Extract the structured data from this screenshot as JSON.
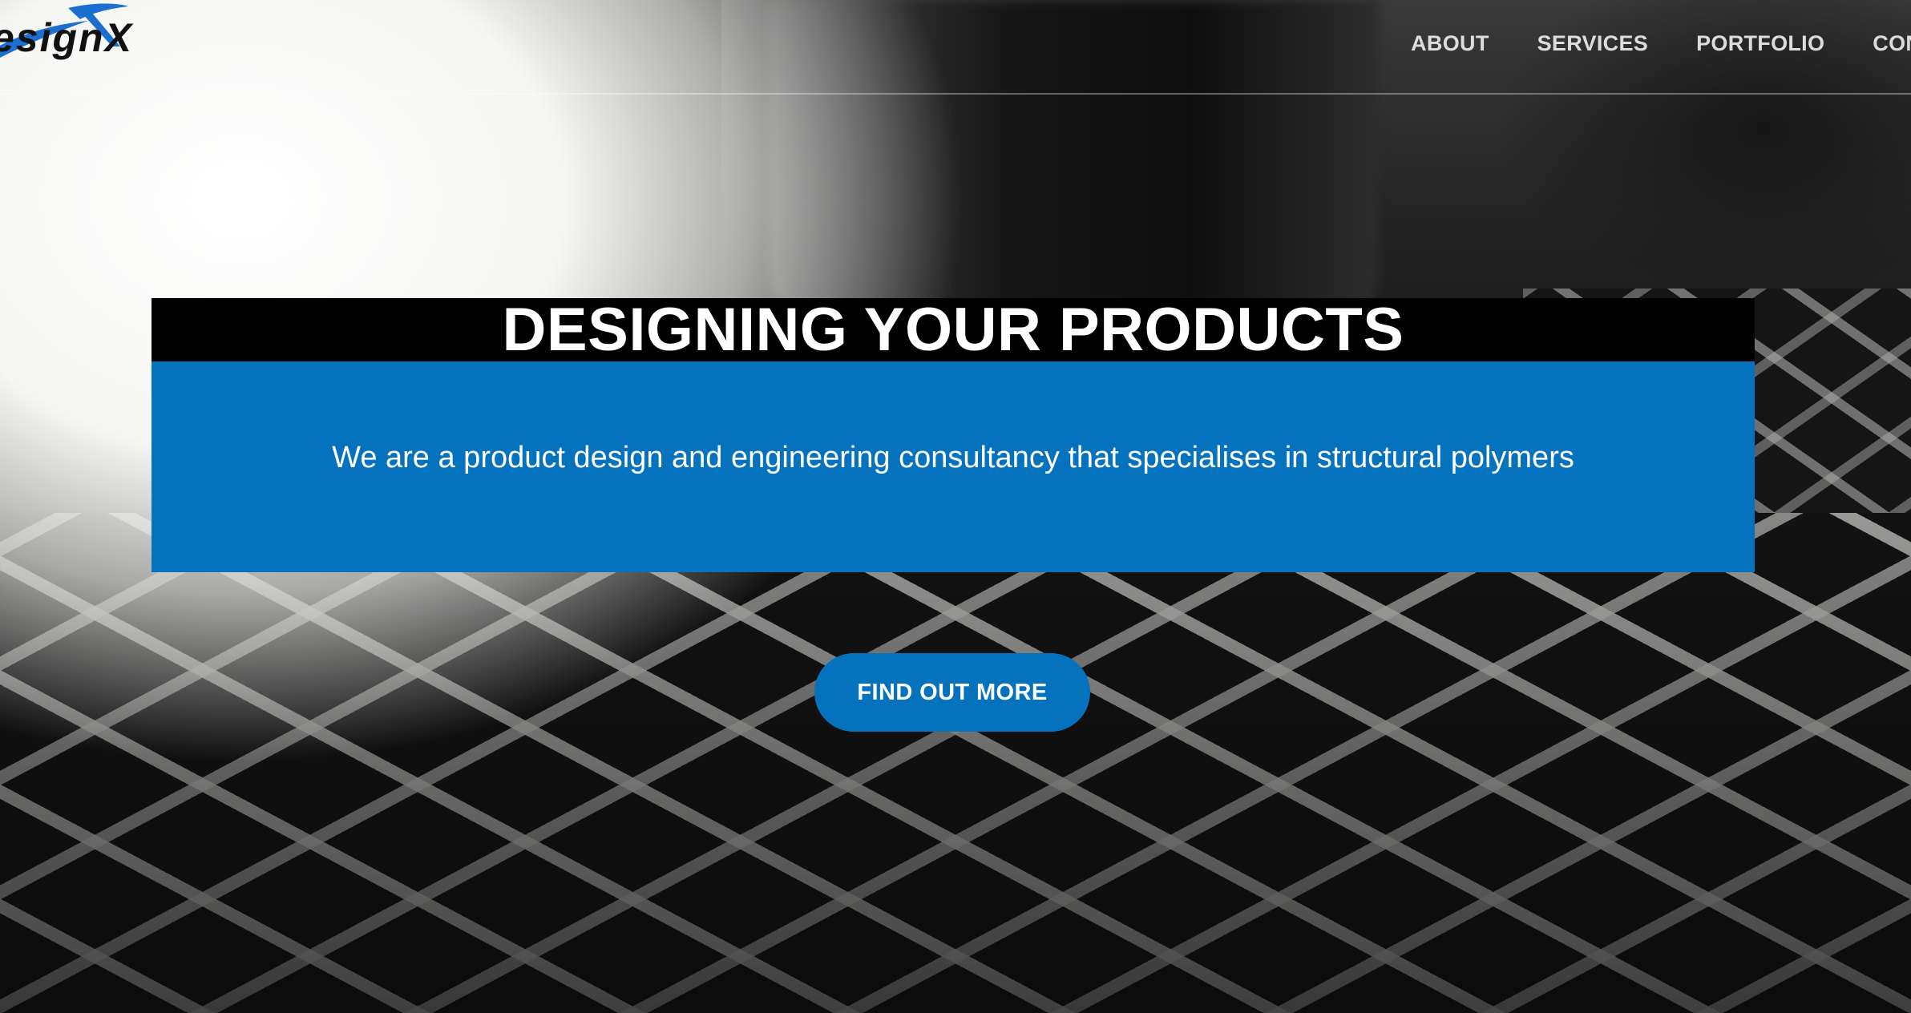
{
  "header": {
    "logo_text": "esignX",
    "nav": [
      {
        "label": "ABOUT"
      },
      {
        "label": "SERVICES"
      },
      {
        "label": "PORTFOLIO"
      },
      {
        "label": "CONT"
      }
    ]
  },
  "hero": {
    "title": "DESIGNING YOUR PRODUCTS",
    "tagline": "We are a product design and engineering consultancy that specialises in structural polymers",
    "cta_label": "FIND OUT MORE"
  },
  "colors": {
    "brand_blue": "#0572bd",
    "title_bar": "#000000",
    "nav_text": "#ebebeb"
  }
}
